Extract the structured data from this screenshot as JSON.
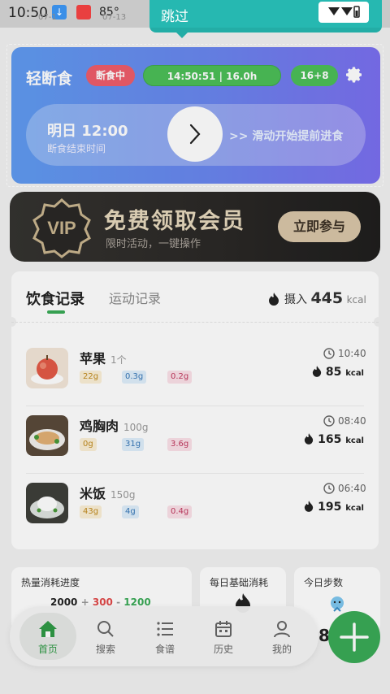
{
  "status_bar": {
    "time": "10:50",
    "temperature": "85°",
    "date_left": "07-1",
    "date_right": "07-13"
  },
  "skip_banner": {
    "label": "跳过"
  },
  "fasting": {
    "title": "轻断食",
    "status": "断食中",
    "timer": "14:50:51 | 16.0h",
    "plan": "16+8",
    "end_time": "明日 12:00",
    "end_label": "断食结束时间",
    "slide_hint": ">> 滑动开始提前进食"
  },
  "vip": {
    "title": "免费领取会员",
    "subtitle": "限时活动，一键操作",
    "button": "立即参与",
    "badge": "VIP"
  },
  "records": {
    "tab_diet": "饮食记录",
    "tab_exercise": "运动记录",
    "intake_label": "摄入",
    "intake_value": "445",
    "intake_unit": "kcal",
    "items": [
      {
        "name": "苹果",
        "qty": "1个",
        "carb": "22g",
        "protein": "0.3g",
        "fat": "0.2g",
        "time": "10:40",
        "kcal": "85",
        "unit": "kcal"
      },
      {
        "name": "鸡胸肉",
        "qty": "100g",
        "carb": "0g",
        "protein": "31g",
        "fat": "3.6g",
        "time": "08:40",
        "kcal": "165",
        "unit": "kcal"
      },
      {
        "name": "米饭",
        "qty": "150g",
        "carb": "43g",
        "protein": "4g",
        "fat": "0.4g",
        "time": "06:40",
        "kcal": "195",
        "unit": "kcal"
      }
    ]
  },
  "stats": {
    "burn_title": "热量消耗进度",
    "burn_base": "2000",
    "burn_plus": "+",
    "burn_extra": "300",
    "burn_minus": "-",
    "burn_intake": "1200",
    "bmr_title": "每日基础消耗",
    "steps_title": "今日步数",
    "steps_value": "8"
  },
  "nav": {
    "home": "首页",
    "search": "搜索",
    "recipes": "食谱",
    "history": "历史",
    "profile": "我的"
  },
  "colors": {
    "accent_green": "#3aaa57",
    "card_gradient_start": "#5f9bf1",
    "card_gradient_end": "#7b6ff0",
    "status_red": "#ef5d6b",
    "teal": "#26b8b1"
  }
}
